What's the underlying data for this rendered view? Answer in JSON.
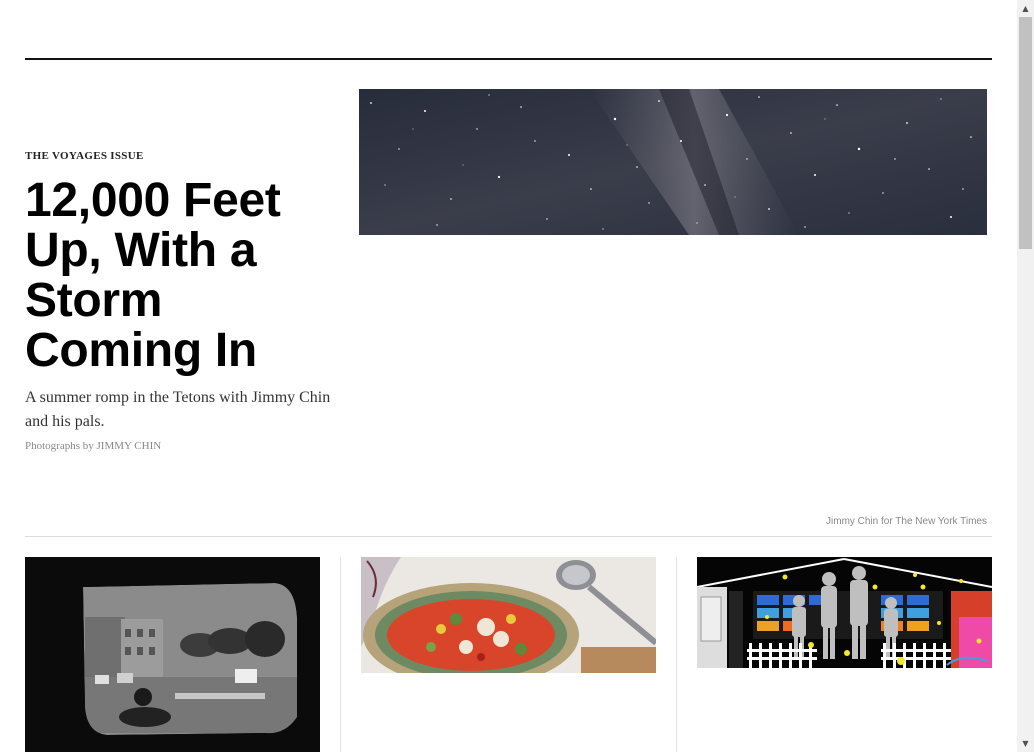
{
  "hero": {
    "kicker": "THE VOYAGES ISSUE",
    "headline": "12,000 Feet Up, With a Storm Coming In",
    "summary": "A summer romp in the Tetons with Jimmy Chin and his pals.",
    "byline": "Photographs by JIMMY CHIN",
    "image_credit": "Jimmy Chin for The New York Times",
    "image": "night-sky-milky-way-photo"
  },
  "cards": [
    {
      "image": "car-window-street-motorcycle-photo"
    },
    {
      "image": "minestrone-soup-bowl-photo"
    },
    {
      "image": "family-silhouettes-neon-house-illustration"
    }
  ],
  "icons": {
    "scroll_up": "scroll-up-arrow-icon",
    "scroll_down": "scroll-down-arrow-icon"
  }
}
